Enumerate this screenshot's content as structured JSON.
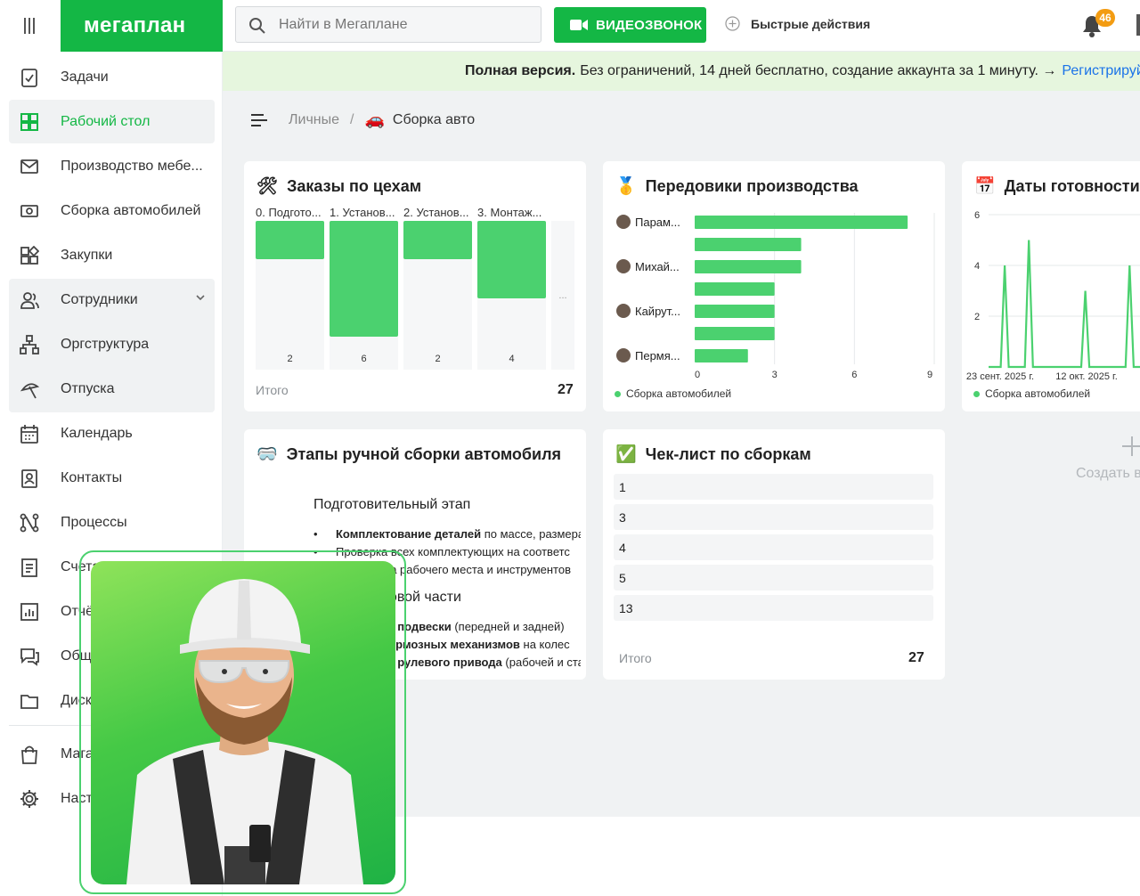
{
  "app": {
    "logo": "мегаплан"
  },
  "sidebar": {
    "items": [
      {
        "label": "Задачи",
        "icon": "task-icon"
      },
      {
        "label": "Рабочий стол",
        "icon": "dashboard-icon",
        "active": true
      },
      {
        "label": "Производство мебе...",
        "icon": "envelope-icon"
      },
      {
        "label": "Сборка автомобилей",
        "icon": "money-icon"
      },
      {
        "label": "Закупки",
        "icon": "shapes-icon"
      },
      {
        "label": "Сотрудники",
        "icon": "users-icon"
      },
      {
        "label": "Оргструктура",
        "icon": "orgchart-icon"
      },
      {
        "label": "Отпуска",
        "icon": "vacation-icon"
      },
      {
        "label": "Календарь",
        "icon": "calendar-icon"
      },
      {
        "label": "Контакты",
        "icon": "contacts-icon"
      },
      {
        "label": "Процессы",
        "icon": "process-icon"
      },
      {
        "label": "Счета",
        "icon": "invoice-icon"
      },
      {
        "label": "Отчёты",
        "icon": "report-icon"
      },
      {
        "label": "Общение",
        "icon": "chat-icon"
      },
      {
        "label": "Диск",
        "icon": "folder-icon"
      },
      {
        "label": "Магазин",
        "icon": "shop-icon"
      },
      {
        "label": "Настройки",
        "icon": "gear-icon"
      }
    ]
  },
  "topbar": {
    "search_placeholder": "Найти в Мегаплане",
    "video_label": "ВИДЕОЗВОНОК",
    "quick_label": "Быстрые действия",
    "notifications": "46"
  },
  "promo": {
    "bold": "Полная версия.",
    "text": "Без ограничений, 14 дней бесплатно, создание аккаунта за 1 минуту. →",
    "link": "Регистрируй"
  },
  "breadcrumb": {
    "parent": "Личные",
    "separator": "/",
    "emoji": "🚗",
    "current": "Сборка авто"
  },
  "orders_widget": {
    "emoji": "🛠",
    "title": "Заказы по цехам",
    "total_label": "Итого",
    "total_value": "27",
    "more": "...",
    "chart_data": {
      "type": "bar",
      "categories": [
        "0. Подгото...",
        "1. Установ...",
        "2. Установ...",
        "3. Монтаж..."
      ],
      "values": [
        2,
        6,
        2,
        4
      ],
      "counts": [
        "2",
        "6",
        "2",
        "4"
      ]
    }
  },
  "leaders_widget": {
    "emoji": "🥇",
    "title": "Передовики производства",
    "legend": "Сборка автомобилей",
    "chart_data": {
      "type": "bar",
      "orientation": "horizontal",
      "categories": [
        "Парам...",
        "",
        "Михай...",
        "",
        "Кайрут...",
        "",
        "Пермя..."
      ],
      "values": [
        8,
        4,
        4,
        3,
        3,
        3,
        2
      ],
      "xlim": [
        0,
        9
      ],
      "xticks": [
        "0",
        "3",
        "6",
        "9"
      ],
      "series": [
        {
          "name": "Сборка автомобилей"
        }
      ]
    }
  },
  "dates_widget": {
    "emoji": "📅",
    "title": "Даты готовности",
    "legend": "Сборка автомобилей",
    "chart_data": {
      "type": "line",
      "yticks": [
        "6",
        "4",
        "2"
      ],
      "xticks": [
        "23 сент. 2025 г.",
        "12 окт. 2025 г."
      ],
      "ylim": [
        0,
        6
      ],
      "values": [
        0,
        0,
        0,
        0,
        4,
        0,
        0,
        0,
        0,
        0,
        5,
        0,
        0,
        0,
        0,
        0,
        0,
        0,
        0,
        0,
        0,
        0,
        0,
        0,
        3,
        0,
        0,
        0,
        0,
        0,
        0,
        0,
        0,
        0,
        0,
        4,
        0,
        0,
        0,
        0,
        0,
        0,
        0
      ],
      "series": [
        {
          "name": "Сборка автомобилей"
        }
      ]
    }
  },
  "stages_widget": {
    "emoji": "🥽",
    "title": "Этапы ручной сборки автомобиля",
    "heading1": "Подготовительный этап",
    "items1": [
      {
        "bold": "Комплектование деталей",
        "text": " по массе, размера"
      },
      {
        "bold": "",
        "text": "Проверка всех комплектующих на соответс"
      },
      {
        "bold": "",
        "text": "Подготовка рабочего места и инструментов"
      }
    ],
    "heading2": "Сборка ходовой части",
    "items2": [
      {
        "bold": "Установка подвески",
        "text": " (передней и задней)"
      },
      {
        "bold": "Монтаж тормозных механизмов",
        "text": " на колес"
      },
      {
        "bold": "Установка рулевого привода",
        "text": " (рабочей и ста"
      }
    ]
  },
  "checklist_widget": {
    "emoji": "✅",
    "title": "Чек-лист по сборкам",
    "rows": [
      "1",
      "3",
      "4",
      "5",
      "13"
    ],
    "total_label": "Итого",
    "total_value": "27"
  },
  "create": {
    "label": "Создать в"
  }
}
